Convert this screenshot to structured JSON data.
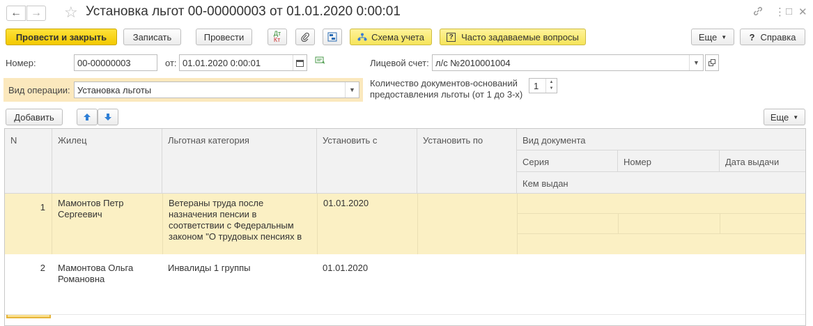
{
  "window": {
    "title": "Установка льгот 00-00000003 от 01.01.2020 0:00:01"
  },
  "toolbar": {
    "post_close": "Провести и закрыть",
    "save": "Записать",
    "post": "Провести",
    "scheme": "Схема учета",
    "faq": "Часто задаваемые вопросы",
    "more": "Еще",
    "help": "Справка",
    "dtkt_top": "Дт",
    "dtkt_bottom": "Кт"
  },
  "form": {
    "number_label": "Номер:",
    "number_value": "00-00000003",
    "date_label": "от:",
    "date_value": "01.01.2020  0:00:01",
    "account_label": "Лицевой счет:",
    "account_value": "л/с №2010001004",
    "operation_label": "Вид операции:",
    "operation_value": "Установка льготы",
    "docs_count_label_1": "Количество документов-оснований",
    "docs_count_label_2": "предоставления льготы (от 1 до 3-х)",
    "docs_count_value": "1"
  },
  "table_toolbar": {
    "add": "Добавить",
    "more": "Еще"
  },
  "table": {
    "columns": {
      "n": "N",
      "resident": "Жилец",
      "category": "Льготная категория",
      "from": "Установить с",
      "to": "Установить по",
      "doc_type": "Вид документа",
      "series": "Серия",
      "number": "Номер",
      "issue_date": "Дата выдачи",
      "issued_by": "Кем выдан"
    },
    "rows": [
      {
        "n": "1",
        "resident_1": "Мамонтов Петр",
        "resident_2": "Сергеевич",
        "category_1": "Ветераны труда после",
        "category_2": "назначения  пенсии в",
        "category_3": "соответствии с Федеральным",
        "category_4": "законом  \"О трудовых пенсиях в",
        "from": "01.01.2020"
      },
      {
        "n": "2",
        "resident_1": "Мамонтова Ольга",
        "resident_2": "Романовна",
        "category_1": "Инвалиды 1 группы",
        "from": "01.01.2020"
      }
    ]
  },
  "icons": {
    "back": "arrow-left-icon",
    "forward": "arrow-right-icon",
    "favorite": "star-icon",
    "link": "link-icon",
    "menu": "more-vertical-icon",
    "maximize": "maximize-icon",
    "close": "close-icon",
    "attach": "paperclip-icon",
    "structure": "structure-icon",
    "calendar": "calendar-icon",
    "comment": "comment-icon",
    "up": "arrow-up-icon",
    "down": "arrow-down-icon"
  },
  "colors": {
    "primary_button": "#f3c900",
    "yellow_button": "#f6e45a",
    "selected_row": "#fbf0c4",
    "operation_highlight": "#fbe8bd"
  }
}
